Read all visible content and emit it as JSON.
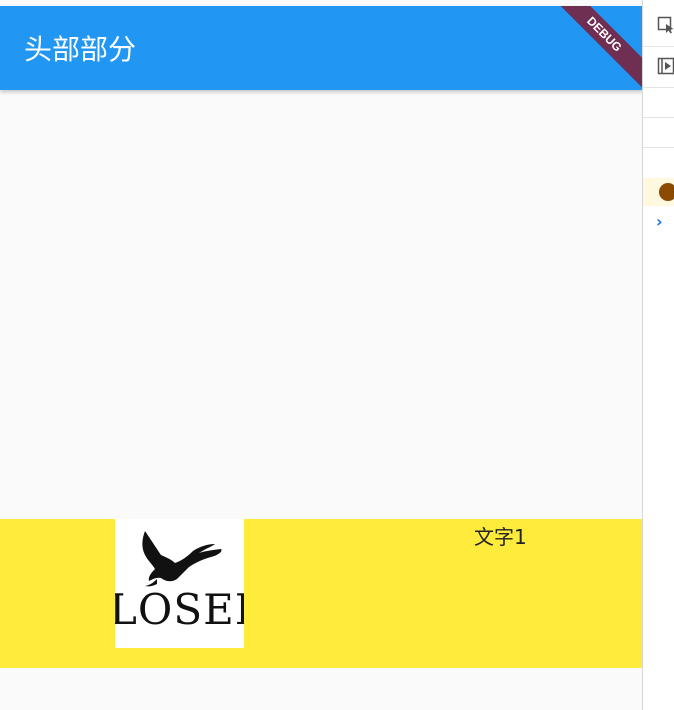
{
  "app_bar": {
    "title": "头部部分",
    "debug_banner": "DEBUG",
    "color": "#2196f3"
  },
  "content": {
    "row_background": "#ffeb3b",
    "logo": {
      "text": "LOSER"
    },
    "text_item": "文字1"
  },
  "side_panel": {
    "icons": [
      "select-widget-icon",
      "performance-overlay-icon",
      "warning-icon",
      "chevron-right-icon"
    ],
    "chevron": "›"
  }
}
